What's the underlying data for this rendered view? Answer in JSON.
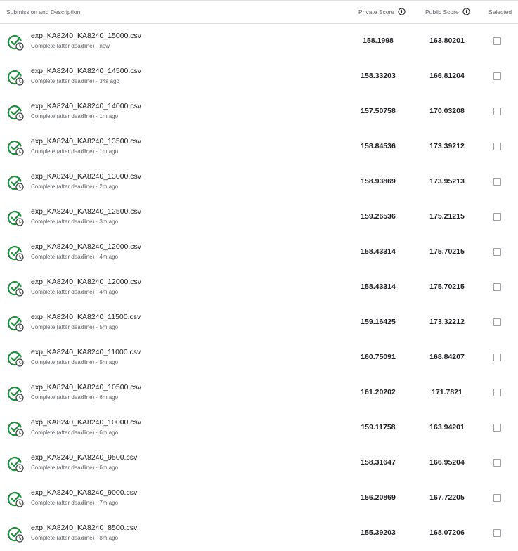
{
  "header": {
    "description": "Submission and Description",
    "private_score": "Private Score",
    "public_score": "Public Score",
    "selected": "Selected"
  },
  "icons": {
    "status": "check-circle-clock-icon",
    "info": "info-icon",
    "status_color": "#1e8e3e"
  },
  "rows": [
    {
      "name": "exp_KA8240_KA8240_15000.csv",
      "meta": "Complete (after deadline) · now",
      "private": "158.1998",
      "public": "163.80201"
    },
    {
      "name": "exp_KA8240_KA8240_14500.csv",
      "meta": "Complete (after deadline) · 34s ago",
      "private": "158.33203",
      "public": "166.81204"
    },
    {
      "name": "exp_KA8240_KA8240_14000.csv",
      "meta": "Complete (after deadline) · 1m ago",
      "private": "157.50758",
      "public": "170.03208"
    },
    {
      "name": "exp_KA8240_KA8240_13500.csv",
      "meta": "Complete (after deadline) · 1m ago",
      "private": "158.84536",
      "public": "173.39212"
    },
    {
      "name": "exp_KA8240_KA8240_13000.csv",
      "meta": "Complete (after deadline) · 2m ago",
      "private": "158.93869",
      "public": "173.95213"
    },
    {
      "name": "exp_KA8240_KA8240_12500.csv",
      "meta": "Complete (after deadline) · 3m ago",
      "private": "159.26536",
      "public": "175.21215"
    },
    {
      "name": "exp_KA8240_KA8240_12000.csv",
      "meta": "Complete (after deadline) · 4m ago",
      "private": "158.43314",
      "public": "175.70215"
    },
    {
      "name": "exp_KA8240_KA8240_12000.csv",
      "meta": "Complete (after deadline) · 4m ago",
      "private": "158.43314",
      "public": "175.70215"
    },
    {
      "name": "exp_KA8240_KA8240_11500.csv",
      "meta": "Complete (after deadline) · 5m ago",
      "private": "159.16425",
      "public": "173.32212"
    },
    {
      "name": "exp_KA8240_KA8240_11000.csv",
      "meta": "Complete (after deadline) · 5m ago",
      "private": "160.75091",
      "public": "168.84207"
    },
    {
      "name": "exp_KA8240_KA8240_10500.csv",
      "meta": "Complete (after deadline) · 6m ago",
      "private": "161.20202",
      "public": "171.7821"
    },
    {
      "name": "exp_KA8240_KA8240_10000.csv",
      "meta": "Complete (after deadline) · 6m ago",
      "private": "159.11758",
      "public": "163.94201"
    },
    {
      "name": "exp_KA8240_KA8240_9500.csv",
      "meta": "Complete (after deadline) · 6m ago",
      "private": "158.31647",
      "public": "166.95204"
    },
    {
      "name": "exp_KA8240_KA8240_9000.csv",
      "meta": "Complete (after deadline) · 7m ago",
      "private": "156.20869",
      "public": "167.72205"
    },
    {
      "name": "exp_KA8240_KA8240_8500.csv",
      "meta": "Complete (after deadline) · 8m ago",
      "private": "155.39203",
      "public": "168.07206"
    }
  ]
}
